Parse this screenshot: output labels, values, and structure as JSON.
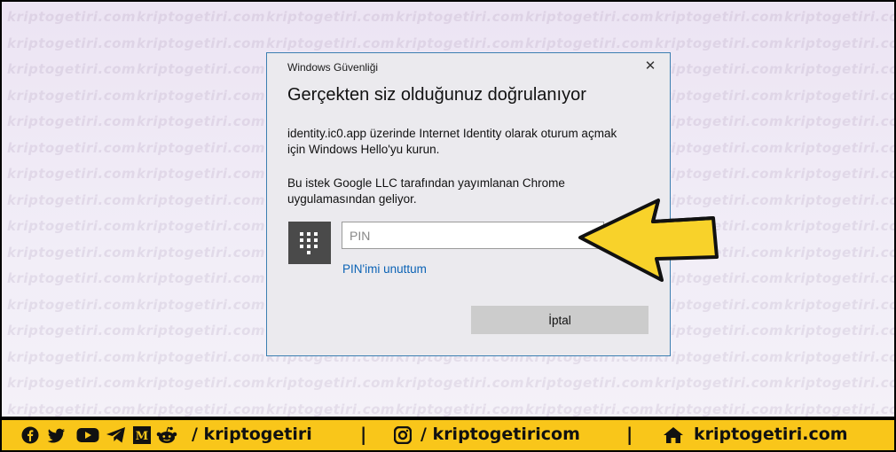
{
  "watermark": "kriptogetiri.com",
  "dialog": {
    "caption": "Windows Güvenliği",
    "close_glyph": "✕",
    "title": "Gerçekten siz olduğunuz doğrulanıyor",
    "message1_line1": "identity.ic0.app üzerinde Internet Identity olarak oturum açmak",
    "message1_line2": "için Windows Hello'yu kurun.",
    "message2_line1": "Bu istek Google LLC tarafından yayımlanan Chrome",
    "message2_line2": "uygulamasından geliyor.",
    "pin_placeholder": "PIN",
    "pin_value": "",
    "forgot_pin": "PIN'imi unuttum",
    "cancel_label": "İptal"
  },
  "footer": {
    "social_handle": "/ kriptogetiri",
    "separator": "|",
    "instagram_handle": "/ kriptogetiricom",
    "website": "kriptogetiri.com",
    "icons": [
      "facebook-icon",
      "twitter-icon",
      "youtube-icon",
      "telegram-icon",
      "medium-icon",
      "reddit-icon",
      "instagram-icon",
      "home-icon"
    ]
  },
  "colors": {
    "footer_bg": "#f9c61a",
    "arrow_fill": "#f8d22a",
    "link": "#0b63b5",
    "dialog_border": "#3c7fb1"
  }
}
